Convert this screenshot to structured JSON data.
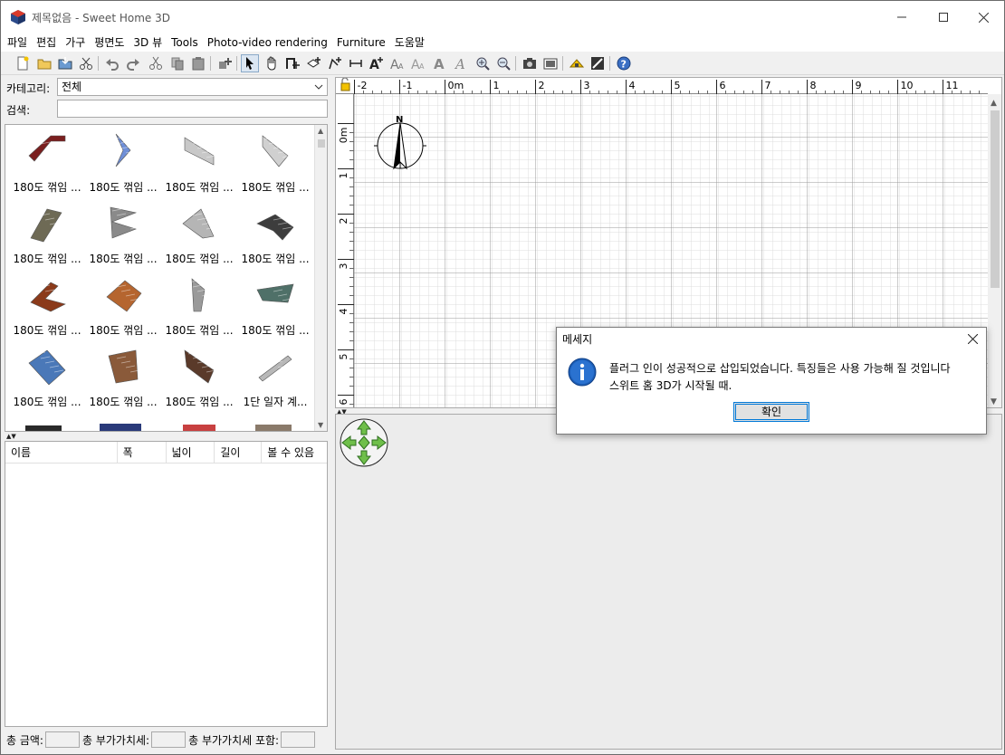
{
  "window": {
    "title": "제목없음 - Sweet Home 3D",
    "brand_color": "#c0392b"
  },
  "menu": [
    "파일",
    "편집",
    "가구",
    "평면도",
    "3D 뷰",
    "Tools",
    "Photo-video rendering",
    "Furniture",
    "도움말"
  ],
  "toolbar": {
    "icons": [
      "new-file-icon",
      "open-file-icon",
      "save-icon",
      "cut-tool-icon",
      "undo-icon",
      "redo-icon",
      "cut-icon",
      "copy-icon",
      "paste-icon",
      "add-furniture-icon",
      "select-mode-icon",
      "pan-mode-icon",
      "create-walls-icon",
      "create-rooms-icon",
      "create-polylines-icon",
      "create-dimensions-icon",
      "add-text-icon",
      "increase-text-icon",
      "decrease-text-icon",
      "bold-text-icon",
      "italic-text-icon",
      "zoom-in-icon",
      "zoom-out-icon",
      "create-photo-icon",
      "create-video-icon",
      "import-furniture-icon",
      "import-texture-icon",
      "help-icon"
    ],
    "active": "select-mode-icon"
  },
  "catalog": {
    "category_label": "카테고리:",
    "category_value": "전체",
    "search_label": "검색:",
    "search_value": "",
    "items": [
      {
        "label": "180도 꺾임 ...",
        "color": "#7a1f1f"
      },
      {
        "label": "180도 꺾임 ...",
        "color": "#6f8fd8"
      },
      {
        "label": "180도 꺾임 ...",
        "color": "#c8c8c8"
      },
      {
        "label": "180도 꺾임 ...",
        "color": "#d0d0d0"
      },
      {
        "label": "180도 꺾임 ...",
        "color": "#6e6a55"
      },
      {
        "label": "180도 꺾임 ...",
        "color": "#8a8a8a"
      },
      {
        "label": "180도 꺾임 ...",
        "color": "#b5b5b5"
      },
      {
        "label": "180도 꺾임 ...",
        "color": "#3d3d3d"
      },
      {
        "label": "180도 꺾임 ...",
        "color": "#8b3a1a"
      },
      {
        "label": "180도 꺾임 ...",
        "color": "#b5652f"
      },
      {
        "label": "180도 꺾임 ...",
        "color": "#9a9a9a"
      },
      {
        "label": "180도 꺾임 ...",
        "color": "#4f7068"
      },
      {
        "label": "180도 꺾임 ...",
        "color": "#4a78b8"
      },
      {
        "label": "180도 꺾임 ...",
        "color": "#8a5a3a"
      },
      {
        "label": "180도 꺾임 ...",
        "color": "#5a3a2a"
      },
      {
        "label": "1단 일자 계...",
        "color": "#b8b8b8"
      }
    ]
  },
  "furniture_table": {
    "columns": [
      "이름",
      "폭",
      "넓이",
      "길이",
      "볼 수 있음"
    ]
  },
  "totals": {
    "total_price": "총 금액:",
    "total_vat": "총 부가가치세:",
    "total_incl_vat": "총 부가가치세 포함:"
  },
  "plan": {
    "x_ticks": [
      "-2",
      "-1",
      "0m",
      "1",
      "2",
      "3",
      "4",
      "5",
      "6",
      "7",
      "8",
      "9",
      "10",
      "11"
    ],
    "y_ticks": [
      "0m",
      "1",
      "2",
      "3",
      "4",
      "5",
      "6"
    ],
    "compass_label": "N"
  },
  "dialog": {
    "title": "메세지",
    "line1": "플러그 인이 성공적으로 삽입되었습니다. 특징들은 사용 가능해 질 것입니다",
    "line2": "스위트 홈 3D가 시작될 때.",
    "ok_label": "확인"
  }
}
